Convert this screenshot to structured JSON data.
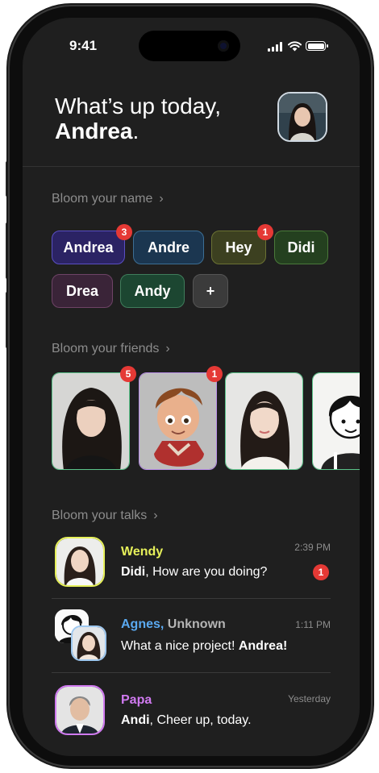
{
  "status_bar": {
    "time": "9:41"
  },
  "header": {
    "greeting_line1": "What’s up today,",
    "user_name": "Andrea",
    "punct": "."
  },
  "names_section": {
    "title": "Bloom your name",
    "chevron": "›",
    "chips": [
      {
        "label": "Andrea",
        "badge": "3",
        "bg": "#2b2364",
        "border": "#5a4fc4"
      },
      {
        "label": "Andre",
        "badge": "",
        "bg": "#1b3650",
        "border": "#3c6e94"
      },
      {
        "label": "Hey",
        "badge": "1",
        "bg": "#3c4020",
        "border": "#6b7233"
      },
      {
        "label": "Didi",
        "badge": "",
        "bg": "#24401f",
        "border": "#4a7a3a"
      },
      {
        "label": "Drea",
        "badge": "",
        "bg": "#3a2438",
        "border": "#6e4366"
      },
      {
        "label": "Andy",
        "badge": "",
        "bg": "#1c4631",
        "border": "#3f7d5b"
      },
      {
        "label": "+",
        "badge": "",
        "bg": "#3b3b3b",
        "border": "#555555"
      }
    ]
  },
  "friends_section": {
    "title": "Bloom your friends",
    "chevron": "›",
    "cards": [
      {
        "badge": "5",
        "border": "#5bc48a",
        "icon": "woman-photo"
      },
      {
        "badge": "1",
        "border": "#b98ee8",
        "icon": "cartoon-boy"
      },
      {
        "badge": "",
        "border": "#5bc48a",
        "icon": "woman-photo"
      },
      {
        "badge": "",
        "border": "#5bc48a",
        "icon": "line-drawing-boy"
      }
    ]
  },
  "talks_section": {
    "title": "Bloom your talks",
    "chevron": "›",
    "items": [
      {
        "name": "Wendy",
        "name_color": "#e6f05a",
        "sender": "Didi",
        "text": ", How are you doing?",
        "time": "2:39 PM",
        "badge": "1",
        "avatar_border": "#e6f05a"
      },
      {
        "name": "Agnes,",
        "name2": " Unknown",
        "name_color": "#5aa9f0",
        "name2_color": "#b5b5b5",
        "text": "What a nice project! ",
        "bold_tail": "Andrea!",
        "time": "1:11 PM"
      },
      {
        "name": "Papa",
        "name_color": "#d07af0",
        "sender": "Andi",
        "text": ", Cheer up, today.",
        "time": "Yesterday",
        "avatar_border": "#d07af0"
      }
    ]
  }
}
